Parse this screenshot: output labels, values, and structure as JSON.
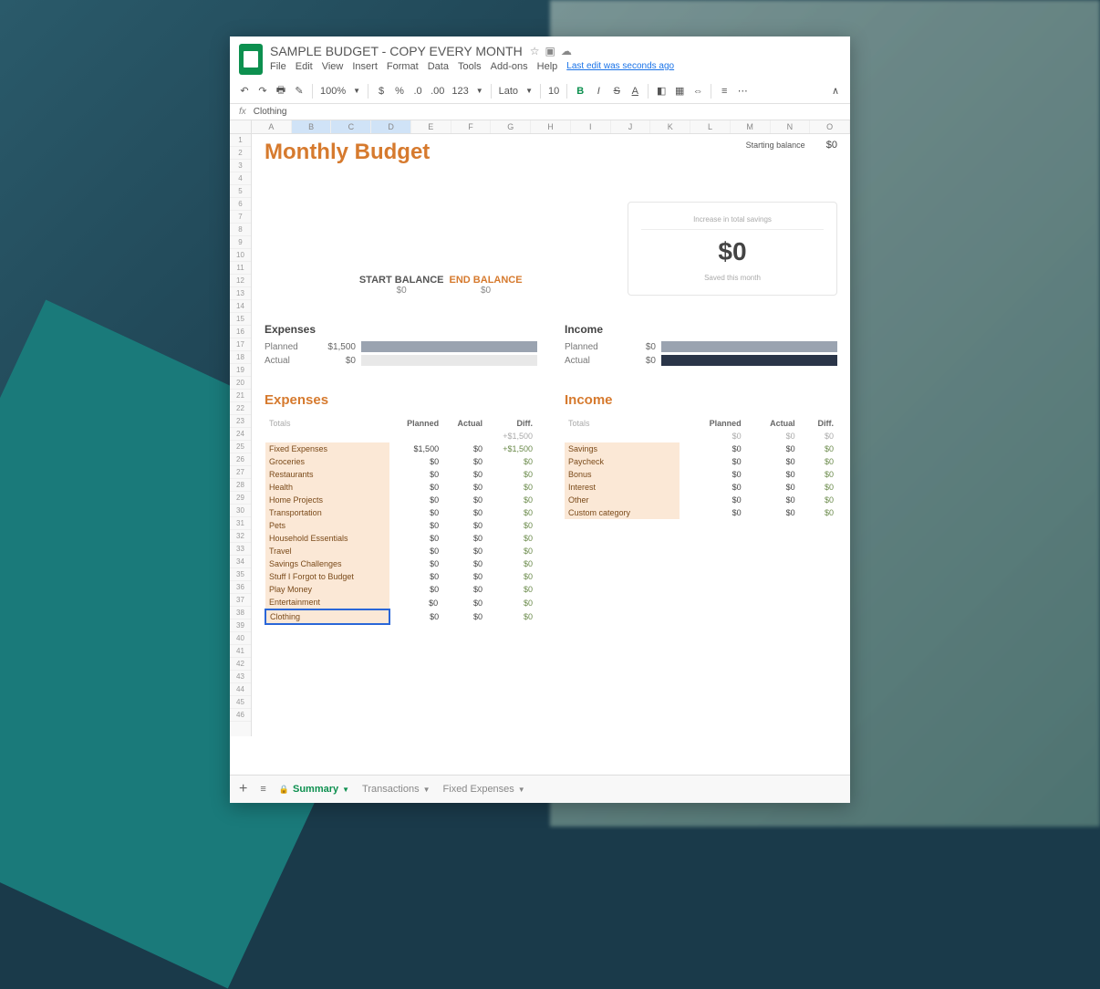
{
  "doc": {
    "title": "SAMPLE BUDGET - COPY EVERY MONTH",
    "last_edit": "Last edit was seconds ago"
  },
  "menu": {
    "file": "File",
    "edit": "Edit",
    "view": "View",
    "insert": "Insert",
    "format": "Format",
    "data": "Data",
    "tools": "Tools",
    "addons": "Add-ons",
    "help": "Help"
  },
  "toolbar": {
    "zoom": "100%",
    "num_format": "123",
    "font": "Lato",
    "font_size": "10",
    "bold": "B",
    "italic": "I",
    "strike": "S",
    "underline": "A"
  },
  "namebox": {
    "fx": "fx",
    "value": "Clothing"
  },
  "cols": [
    "A",
    "B",
    "C",
    "D",
    "E",
    "F",
    "G",
    "H",
    "I",
    "J",
    "K",
    "L",
    "M",
    "N",
    "O"
  ],
  "header": {
    "title": "Monthly Budget",
    "start_label": "Starting balance",
    "start_value": "$0"
  },
  "balances": {
    "start_lbl": "START BALANCE",
    "start_val": "$0",
    "end_lbl": "END BALANCE",
    "end_val": "$0"
  },
  "savings": {
    "top": "Increase in total savings",
    "amount": "$0",
    "bottom": "Saved this month"
  },
  "exp_summary": {
    "title": "Expenses",
    "planned_lbl": "Planned",
    "planned_val": "$1,500",
    "actual_lbl": "Actual",
    "actual_val": "$0"
  },
  "inc_summary": {
    "title": "Income",
    "planned_lbl": "Planned",
    "planned_val": "$0",
    "actual_lbl": "Actual",
    "actual_val": "$0"
  },
  "exp_detail": {
    "title": "Expenses",
    "hdr": {
      "name": "Totals",
      "planned": "Planned",
      "actual": "Actual",
      "diff": "Diff."
    },
    "total": {
      "planned": "",
      "actual": "",
      "diff": "+$1,500"
    },
    "rows": [
      {
        "name": "Fixed Expenses",
        "planned": "$1,500",
        "actual": "$0",
        "diff": "+$1,500"
      },
      {
        "name": "Groceries",
        "planned": "$0",
        "actual": "$0",
        "diff": "$0"
      },
      {
        "name": "Restaurants",
        "planned": "$0",
        "actual": "$0",
        "diff": "$0"
      },
      {
        "name": "Health",
        "planned": "$0",
        "actual": "$0",
        "diff": "$0"
      },
      {
        "name": "Home Projects",
        "planned": "$0",
        "actual": "$0",
        "diff": "$0"
      },
      {
        "name": "Transportation",
        "planned": "$0",
        "actual": "$0",
        "diff": "$0"
      },
      {
        "name": "Pets",
        "planned": "$0",
        "actual": "$0",
        "diff": "$0"
      },
      {
        "name": "Household Essentials",
        "planned": "$0",
        "actual": "$0",
        "diff": "$0"
      },
      {
        "name": "Travel",
        "planned": "$0",
        "actual": "$0",
        "diff": "$0"
      },
      {
        "name": "Savings Challenges",
        "planned": "$0",
        "actual": "$0",
        "diff": "$0"
      },
      {
        "name": "Stuff I Forgot to Budget",
        "planned": "$0",
        "actual": "$0",
        "diff": "$0"
      },
      {
        "name": "Play Money",
        "planned": "$0",
        "actual": "$0",
        "diff": "$0"
      },
      {
        "name": "Entertainment",
        "planned": "$0",
        "actual": "$0",
        "diff": "$0"
      },
      {
        "name": "Clothing",
        "planned": "$0",
        "actual": "$0",
        "diff": "$0"
      }
    ]
  },
  "inc_detail": {
    "title": "Income",
    "hdr": {
      "name": "Totals",
      "planned": "Planned",
      "actual": "Actual",
      "diff": "Diff."
    },
    "total": {
      "planned": "$0",
      "actual": "$0",
      "diff": "$0"
    },
    "rows": [
      {
        "name": "Savings",
        "planned": "$0",
        "actual": "$0",
        "diff": "$0"
      },
      {
        "name": "Paycheck",
        "planned": "$0",
        "actual": "$0",
        "diff": "$0"
      },
      {
        "name": "Bonus",
        "planned": "$0",
        "actual": "$0",
        "diff": "$0"
      },
      {
        "name": "Interest",
        "planned": "$0",
        "actual": "$0",
        "diff": "$0"
      },
      {
        "name": "Other",
        "planned": "$0",
        "actual": "$0",
        "diff": "$0"
      },
      {
        "name": "Custom category",
        "planned": "$0",
        "actual": "$0",
        "diff": "$0"
      }
    ]
  },
  "tabs": {
    "summary": "Summary",
    "transactions": "Transactions",
    "fixed": "Fixed Expenses"
  }
}
